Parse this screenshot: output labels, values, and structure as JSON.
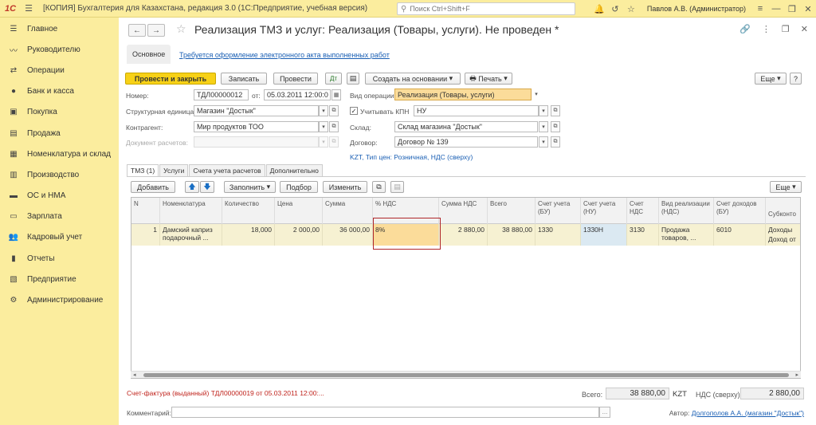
{
  "titlebar": {
    "logo": "1С",
    "title": "[КОПИЯ] Бухгалтерия для Казахстана, редакция 3.0  (1С:Предприятие, учебная версия)",
    "search_placeholder": "Поиск Ctrl+Shift+F",
    "user": "Павлов А.В. (Администратор)"
  },
  "sidebar": {
    "items": [
      {
        "label": "Главное",
        "icon": "menu-icon"
      },
      {
        "label": "Руководителю",
        "icon": "chart-icon"
      },
      {
        "label": "Операции",
        "icon": "operations-icon"
      },
      {
        "label": "Банк и касса",
        "icon": "bank-icon"
      },
      {
        "label": "Покупка",
        "icon": "cart-icon"
      },
      {
        "label": "Продажа",
        "icon": "sale-icon"
      },
      {
        "label": "Номенклатура и склад",
        "icon": "box-icon"
      },
      {
        "label": "Производство",
        "icon": "factory-icon"
      },
      {
        "label": "ОС и НМА",
        "icon": "truck-icon"
      },
      {
        "label": "Зарплата",
        "icon": "salary-icon"
      },
      {
        "label": "Кадровый учет",
        "icon": "people-icon"
      },
      {
        "label": "Отчеты",
        "icon": "report-icon"
      },
      {
        "label": "Предприятие",
        "icon": "building-icon"
      },
      {
        "label": "Администрирование",
        "icon": "gear-icon"
      }
    ]
  },
  "document": {
    "title": "Реализация ТМЗ и услуг: Реализация (Товары, услуги). Не проведен *",
    "tab_basic": "Основное",
    "e_act_link": "Требуется оформление электронного акта выполненных работ"
  },
  "toolbar": {
    "post_close": "Провести и закрыть",
    "save": "Записать",
    "post": "Провести",
    "create_based": "Создать на основании",
    "print": "Печать",
    "more": "Еще"
  },
  "form": {
    "number_label": "Номер:",
    "number": "ТДЛ00000012",
    "from_label": "от:",
    "date": "05.03.2011 12:00:0",
    "op_type_label": "Вид операции:",
    "op_type": "Реализация (Товары, услуги)",
    "division_label": "Структурная единица:",
    "division": "Магазин \"Достык\"",
    "kpn_label": "Учитывать КПН",
    "kpn_checked": "✓",
    "kpn": "НУ",
    "counterparty_label": "Контрагент:",
    "counterparty": "Мир продуктов ТОО",
    "warehouse_label": "Склад:",
    "warehouse": "Склад магазина \"Достык\"",
    "settlement_label": "Документ расчетов:",
    "contract_label": "Договор:",
    "contract": "Договор № 139",
    "price_line": "KZT, Тип цен: Розничная, НДС (сверху)"
  },
  "inner_tabs": [
    "ТМЗ (1)",
    "Услуги",
    "Счета учета расчетов",
    "Дополнительно"
  ],
  "table_toolbar": {
    "add": "Добавить",
    "fill": "Заполнить",
    "select": "Подбор",
    "change": "Изменить",
    "more": "Еще"
  },
  "table": {
    "columns": [
      "N",
      "Номенклатура",
      "Количество",
      "Цена",
      "Сумма",
      "% НДС",
      "Сумма НДС",
      "Всего",
      "Счет учета (БУ)",
      "Счет учета (НУ)",
      "Счет НДС",
      "Вид реализации (НДС)",
      "Счет доходов (БУ)",
      "Субконто"
    ],
    "rows": [
      {
        "n": "1",
        "item": "Дамский каприз подарочный ...",
        "qty": "18,000",
        "price": "2 000,00",
        "sum": "36 000,00",
        "vat_rate": "8%",
        "vat_sum": "2 880,00",
        "total": "38 880,00",
        "acc_bu": "1330",
        "acc_nu": "1330Н",
        "acc_vat": "3130",
        "sale_type": "Продажа товаров, ...",
        "income_acc": "6010",
        "subconto1": "Доходы",
        "subconto2": "Доход от"
      }
    ]
  },
  "footer": {
    "invoice": "Счет-фактура (выданный) ТДЛ00000019 от 05.03.2011 12:00:...",
    "total_label": "Всего:",
    "total": "38 880,00",
    "currency": "KZT",
    "vat_label": "НДС (сверху):",
    "vat": "2 880,00",
    "comment_label": "Комментарий:",
    "comment": "",
    "author_label": "Автор:",
    "author": "Долгополов А.А. (магазин \"Достык\")"
  }
}
